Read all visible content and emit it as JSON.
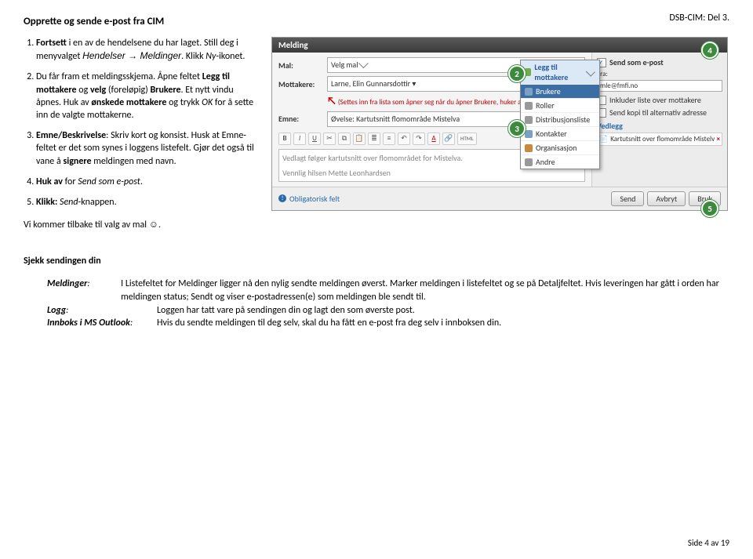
{
  "header": {
    "docref": "DSB-CIM: Del 3."
  },
  "title": "Opprette og sende e-post fra CIM",
  "steps": [
    {
      "pre": "Fortsett",
      "mid": " i en av de hendelsene du har laget. Still deg i menyvalget ",
      "path": "Hendelser → Meldinger",
      "post": ". Klikk ",
      "icon": "Ny",
      "post2": "-ikonet."
    },
    {
      "t": "Du får fram et meldingsskjema. Åpne feltet ",
      "b1": "Legg til mottakere",
      "t2": " og ",
      "b2": "velg",
      "t3": " (foreløpig) ",
      "b3": "Brukere",
      "t4": ". Et nytt vindu åpnes. Huk av ",
      "b4": "ønskede mottakere",
      "t5": " og trykk ",
      "i1": "OK",
      "t6": " for å sette inn de valgte mottakerne."
    },
    {
      "b1": "Emne/Beskrivelse",
      "t2": ": Skriv kort og konsist. Husk at Emne-feltet er det som synes i loggens listefelt. Gjør det også til vane å ",
      "b2": "signere",
      "t3": " meldingen med navn."
    },
    {
      "b1": "Huk av",
      "t2": " for ",
      "i1": "Send som e-post",
      "t3": "."
    },
    {
      "b1": "Klikk:",
      "t2": " ",
      "i1": "Send",
      "t3": "-knappen."
    }
  ],
  "postline": {
    "t1": "Vi kommer tilbake til valg av mal ",
    "smile": "☺",
    "t2": "."
  },
  "shot": {
    "title": "Melding",
    "labels": {
      "mal": "Mal:",
      "mottakere": "Mottakere:",
      "emne": "Emne:"
    },
    "mal_value": "Velg mal",
    "mottakere_value": "Larne, Elin Gunnarsdottir ▾",
    "note": "(Settes inn fra lista som åpner seg når du åpner Brukere, huker av og trykker OK.)",
    "emne_value": "Øvelse: Kartutsnitt flomområde Mistelva",
    "menu": {
      "header": "Legg til mottakere",
      "items": [
        "Brukere",
        "Roller",
        "Distribusjonsliste",
        "Kontakter",
        "Organisasjon",
        "Andre"
      ]
    },
    "editor": {
      "l1": "Vedlagt følger kartutsnitt over flomområdet for Mistelva.",
      "l2": "Vennlig hilsen Mette Leonhardsen"
    },
    "right": {
      "chk_send": "Send som e-post",
      "fra": "Fra:",
      "fra_value": "mle@fmfi.no",
      "chk_list": "Inkluder liste over mottakere",
      "chk_kopi": "Send kopi til alternativ adresse",
      "vedlegg": "Vedlegg",
      "attach": "Kartutsnitt over flomområde Mistelva.docx"
    },
    "bottom": {
      "oblig": "Obligatorisk felt",
      "send": "Send",
      "avbryt": "Avbryt",
      "bruk": "Bruk"
    },
    "callouts": {
      "c2": "2",
      "c3": "3",
      "c4": "4",
      "c5": "5"
    }
  },
  "check": {
    "title": "Sjekk sendingen din",
    "items": [
      {
        "term": "Meldinger",
        "body": "I Listefeltet for Meldinger ligger nå den nylig sendte meldingen øverst. Marker meldingen i listefeltet og se på Detaljfeltet. Hvis leveringen har gått i orden har meldingen status; Sendt og viser e-postadressen(e) som meldingen ble sendt til."
      },
      {
        "term": "Logg",
        "body": "Loggen har tatt vare på sendingen din og lagt den som øverste post."
      },
      {
        "term": "Innboks i MS Outlook",
        "body": "Hvis du sendte meldingen til deg selv, skal du ha fått en e-post fra deg selv i innboksen din."
      }
    ]
  },
  "footer": "Side 4 av 19"
}
